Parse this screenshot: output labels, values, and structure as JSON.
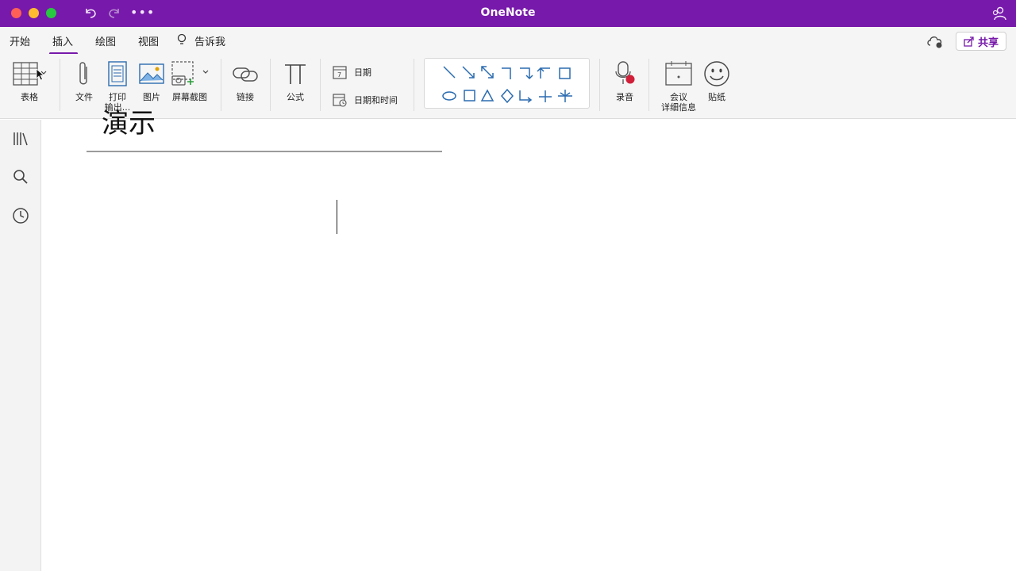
{
  "window": {
    "title": "OneNote"
  },
  "tabs": [
    {
      "label": "开始"
    },
    {
      "label": "插入"
    },
    {
      "label": "绘图"
    },
    {
      "label": "视图"
    },
    {
      "label": "告诉我"
    }
  ],
  "share": {
    "label": "共享"
  },
  "ribbon": {
    "table": "表格",
    "file": "文件",
    "printout_line1": "打印",
    "printout_line2": "输出...",
    "picture": "图片",
    "screenshot": "屏幕截图",
    "link": "链接",
    "equation": "公式",
    "date": "日期",
    "date_time": "日期和时间",
    "record": "录音",
    "meeting_line1": "会议",
    "meeting_line2": "详细信息",
    "sticker": "贴纸"
  },
  "page": {
    "title": "演示"
  },
  "colors": {
    "accent": "#7719aa",
    "titlebar": "#7719aa"
  }
}
